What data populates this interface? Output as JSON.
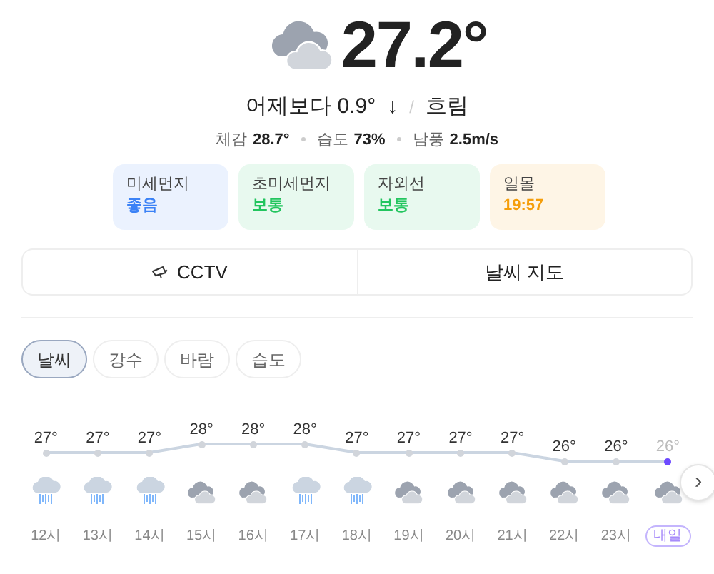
{
  "current": {
    "temperature": "27.2°",
    "compare": "어제보다 0.9°",
    "trend": "↓",
    "separator": "/",
    "condition": "흐림",
    "details": [
      {
        "label": "체감",
        "value": "28.7°"
      },
      {
        "label": "습도",
        "value": "73%"
      },
      {
        "label": "남풍",
        "value": "2.5m/s"
      }
    ]
  },
  "cards": [
    {
      "label": "미세먼지",
      "value": "좋음",
      "color": "#3b82f6"
    },
    {
      "label": "초미세먼지",
      "value": "보통",
      "color": "#22c55e"
    },
    {
      "label": "자외선",
      "value": "보통",
      "color": "#22c55e"
    },
    {
      "label": "일몰",
      "value": "19:57",
      "color": "#f59e0b"
    }
  ],
  "links": [
    {
      "label": "CCTV",
      "icon": true
    },
    {
      "label": "날씨 지도",
      "icon": false
    }
  ],
  "tabs": [
    {
      "label": "날씨",
      "selected": true
    },
    {
      "label": "강수",
      "selected": false
    },
    {
      "label": "바람",
      "selected": false
    },
    {
      "label": "습도",
      "selected": false
    }
  ],
  "hourly": [
    {
      "temp": "27°",
      "kind": "rain",
      "time": "12시",
      "badge": false,
      "selected": false
    },
    {
      "temp": "27°",
      "kind": "rain",
      "time": "13시",
      "badge": false,
      "selected": false
    },
    {
      "temp": "27°",
      "kind": "rain",
      "time": "14시",
      "badge": false,
      "selected": false
    },
    {
      "temp": "28°",
      "kind": "cloudy",
      "time": "15시",
      "badge": false,
      "selected": false
    },
    {
      "temp": "28°",
      "kind": "cloudy",
      "time": "16시",
      "badge": false,
      "selected": false
    },
    {
      "temp": "28°",
      "kind": "rain",
      "time": "17시",
      "badge": false,
      "selected": false
    },
    {
      "temp": "27°",
      "kind": "rain",
      "time": "18시",
      "badge": false,
      "selected": false
    },
    {
      "temp": "27°",
      "kind": "cloudy",
      "time": "19시",
      "badge": false,
      "selected": false
    },
    {
      "temp": "27°",
      "kind": "cloudy",
      "time": "20시",
      "badge": false,
      "selected": false
    },
    {
      "temp": "27°",
      "kind": "cloudy",
      "time": "21시",
      "badge": false,
      "selected": false
    },
    {
      "temp": "26°",
      "kind": "cloudy",
      "time": "22시",
      "badge": false,
      "selected": false
    },
    {
      "temp": "26°",
      "kind": "cloudy",
      "time": "23시",
      "badge": false,
      "selected": false
    },
    {
      "temp": "26°",
      "kind": "cloudy",
      "time": "내일",
      "badge": true,
      "selected": true
    }
  ],
  "next_button": "›"
}
